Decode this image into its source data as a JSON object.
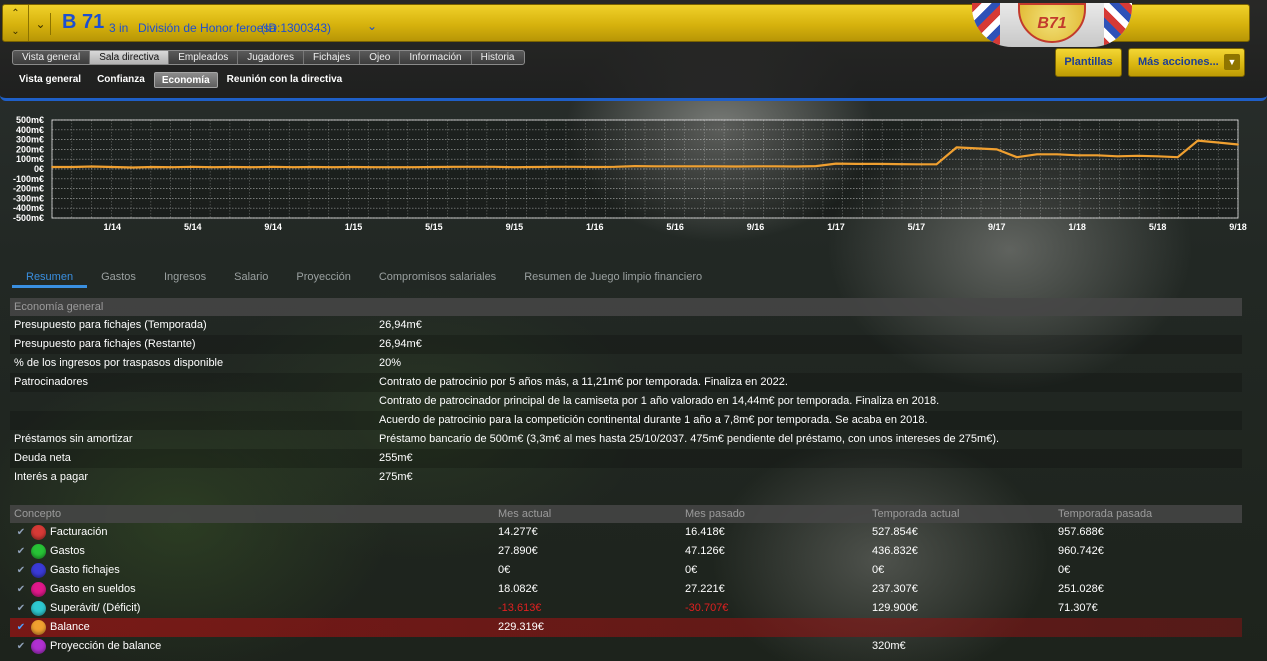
{
  "header": {
    "club_name": "B 71",
    "club_level": "3 in",
    "league": "División de Honor feroesa",
    "club_id": "(ID:1300343)",
    "crest_text": "B71",
    "main_tabs": [
      {
        "label": "Vista general",
        "active": false
      },
      {
        "label": "Sala directiva",
        "active": true
      },
      {
        "label": "Empleados",
        "active": false
      },
      {
        "label": "Jugadores",
        "active": false
      },
      {
        "label": "Fichajes",
        "active": false
      },
      {
        "label": "Ojeo",
        "active": false
      },
      {
        "label": "Información",
        "active": false
      },
      {
        "label": "Historia",
        "active": false
      }
    ],
    "sub_tabs": [
      {
        "label": "Vista general",
        "active": false
      },
      {
        "label": "Confianza",
        "active": false
      },
      {
        "label": "Economía",
        "active": true
      },
      {
        "label": "Reunión con la directiva",
        "active": false
      }
    ],
    "btn_plantillas": "Plantillas",
    "btn_more": "Más acciones..."
  },
  "chart_data": {
    "type": "line",
    "series": [
      {
        "color": "#f0a030",
        "x": [
          "2013-10",
          "2013-11",
          "2013-12",
          "2014-01",
          "2014-02",
          "2014-03",
          "2014-04",
          "2014-05",
          "2014-06",
          "2014-07",
          "2014-08",
          "2014-09",
          "2014-10",
          "2014-11",
          "2014-12",
          "2015-01",
          "2015-02",
          "2015-03",
          "2015-04",
          "2015-05",
          "2015-06",
          "2015-07",
          "2015-08",
          "2015-09",
          "2015-10",
          "2015-11",
          "2015-12",
          "2016-01",
          "2016-02",
          "2016-03",
          "2016-04",
          "2016-05",
          "2016-06",
          "2016-07",
          "2016-08",
          "2016-09",
          "2016-10",
          "2016-11",
          "2016-12",
          "2017-01",
          "2017-02",
          "2017-03",
          "2017-04",
          "2017-05",
          "2017-06",
          "2017-07",
          "2017-08",
          "2017-09",
          "2017-10",
          "2017-11",
          "2017-12",
          "2018-01",
          "2018-02",
          "2018-03",
          "2018-04",
          "2018-05",
          "2018-06",
          "2018-07",
          "2018-08",
          "2018-09"
        ],
        "values": [
          20,
          20,
          25,
          20,
          15,
          20,
          18,
          22,
          18,
          20,
          18,
          22,
          18,
          20,
          18,
          20,
          18,
          18,
          18,
          20,
          22,
          22,
          22,
          18,
          20,
          22,
          22,
          20,
          22,
          30,
          28,
          28,
          28,
          28,
          25,
          28,
          28,
          25,
          30,
          55,
          52,
          52,
          50,
          48,
          48,
          220,
          210,
          200,
          120,
          150,
          150,
          140,
          140,
          130,
          135,
          130,
          120,
          290,
          270,
          250
        ]
      }
    ],
    "y_ticks": [
      "500m€",
      "400m€",
      "300m€",
      "200m€",
      "100m€",
      "0€",
      "-100m€",
      "-200m€",
      "-300m€",
      "-400m€",
      "-500m€"
    ],
    "x_ticks": [
      "1/14",
      "5/14",
      "9/14",
      "1/15",
      "5/15",
      "9/15",
      "1/16",
      "5/16",
      "9/16",
      "1/17",
      "5/17",
      "9/17",
      "1/18",
      "5/18",
      "9/18"
    ],
    "ylim": [
      -500,
      500
    ],
    "grid": true
  },
  "section_tabs": [
    {
      "label": "Resumen",
      "active": true
    },
    {
      "label": "Gastos",
      "active": false
    },
    {
      "label": "Ingresos",
      "active": false
    },
    {
      "label": "Salario",
      "active": false
    },
    {
      "label": "Proyección",
      "active": false
    },
    {
      "label": "Compromisos salariales",
      "active": false
    },
    {
      "label": "Resumen de Juego limpio financiero",
      "active": false
    }
  ],
  "economy": {
    "header": "Economía general",
    "rows": [
      {
        "label": "Presupuesto para fichajes (Temporada)",
        "value": "26,94m€"
      },
      {
        "label": "Presupuesto para fichajes (Restante)",
        "value": "26,94m€"
      },
      {
        "label": "% de los ingresos por traspasos disponible",
        "value": "20%"
      },
      {
        "label": "Patrocinadores",
        "value": "Contrato de patrocinio por 5 años más, a 11,21m€ por temporada. Finaliza en 2022."
      },
      {
        "label": "",
        "value": "Contrato de patrocinador principal de la camiseta por 1 año valorado en 14,44m€ por temporada. Finaliza en 2018."
      },
      {
        "label": "",
        "value": "Acuerdo de patrocinio para la competición continental durante 1 año a 7,8m€ por temporada. Se acaba en 2018."
      },
      {
        "label": "Préstamos sin amortizar",
        "value": "Préstamo bancario de 500m€ (3,3m€ al mes hasta 25/10/2037. 475m€ pendiente del préstamo, con unos intereses de 275m€)."
      },
      {
        "label": "Deuda neta",
        "value": "255m€"
      },
      {
        "label": "Interés a pagar",
        "value": "275m€"
      }
    ]
  },
  "finance": {
    "columns": [
      "Concepto",
      "Mes actual",
      "Mes pasado",
      "Temporada actual",
      "Temporada pasada"
    ],
    "rows": [
      {
        "label": "Facturación",
        "color": "#d63a36",
        "checked": false,
        "m1": "14.277€",
        "m2": "16.418€",
        "m3": "527.854€",
        "m4": "957.688€"
      },
      {
        "label": "Gastos",
        "color": "#27c236",
        "checked": false,
        "m1": "27.890€",
        "m2": "47.126€",
        "m3": "436.832€",
        "m4": "960.742€"
      },
      {
        "label": "Gasto fichajes",
        "color": "#3a3ad6",
        "checked": false,
        "m1": "0€",
        "m2": "0€",
        "m3": "0€",
        "m4": "0€"
      },
      {
        "label": "Gasto en sueldos",
        "color": "#e0188a",
        "checked": false,
        "m1": "18.082€",
        "m2": "27.221€",
        "m3": "237.307€",
        "m4": "251.028€"
      },
      {
        "label": "Superávit/ (Déficit)",
        "color": "#2ec8d0",
        "checked": false,
        "m1": "-13.613€",
        "m2": "-30.707€",
        "m3": "129.900€",
        "m4": "71.307€"
      },
      {
        "label": "Balance",
        "color": "#f0a030",
        "checked": true,
        "m1": "229.319€",
        "m2": "",
        "m3": "",
        "m4": ""
      },
      {
        "label": "Proyección de balance",
        "color": "#b030d0",
        "checked": false,
        "m1": "",
        "m2": "",
        "m3": "320m€",
        "m4": ""
      }
    ]
  }
}
